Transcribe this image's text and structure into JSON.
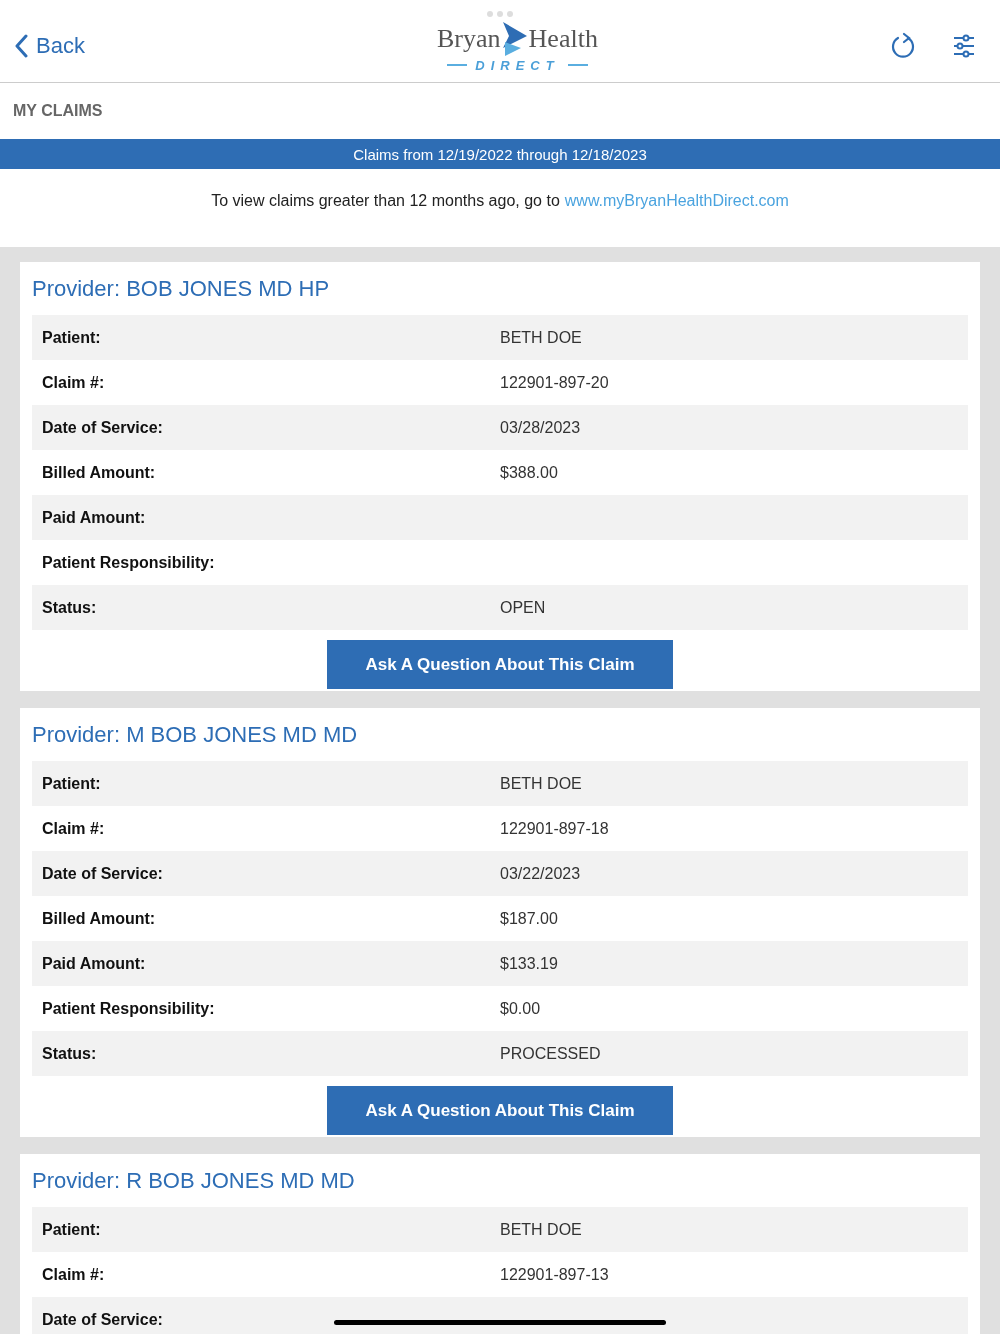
{
  "header": {
    "back": "Back",
    "logo": {
      "left": "Bryan",
      "right": "Health",
      "tagline": "DIRECT"
    }
  },
  "section_title": "MY CLAIMS",
  "banner": "Claims from 12/19/2022 through 12/18/2023",
  "notice": {
    "text": "To view claims greater than 12 months ago, go to",
    "link": "www.myBryanHealthDirect.com"
  },
  "claims": [
    {
      "provider": "Provider: BOB JONES MD HP",
      "rows": [
        {
          "label": "Patient:",
          "value": "BETH DOE"
        },
        {
          "label": "Claim #:",
          "value": "122901-897-20"
        },
        {
          "label": "Date of Service:",
          "value": "03/28/2023"
        },
        {
          "label": "Billed Amount:",
          "value": "$388.00"
        },
        {
          "label": "Paid Amount:"
        },
        {
          "label": "Patient Responsibility:"
        },
        {
          "label": "Status:",
          "value": "OPEN"
        }
      ],
      "button": "Ask A Question About This Claim"
    },
    {
      "provider": "Provider: M BOB JONES MD MD",
      "rows": [
        {
          "label": "Patient:",
          "value": "BETH DOE"
        },
        {
          "label": "Claim #:",
          "value": "122901-897-18"
        },
        {
          "label": "Date of Service:",
          "value": "03/22/2023"
        },
        {
          "label": "Billed Amount:",
          "value": "$187.00"
        },
        {
          "label": "Paid Amount:",
          "value": "$133.19"
        },
        {
          "label": "Patient Responsibility:",
          "value": "$0.00"
        },
        {
          "label": "Status:",
          "value": "PROCESSED"
        }
      ],
      "button": "Ask A Question About This Claim"
    },
    {
      "provider": "Provider: R BOB JONES MD MD",
      "rows": [
        {
          "label": "Patient:",
          "value": "BETH DOE"
        },
        {
          "label": "Claim #:",
          "value": "122901-897-13"
        },
        {
          "label": "Date of Service:"
        }
      ]
    }
  ]
}
